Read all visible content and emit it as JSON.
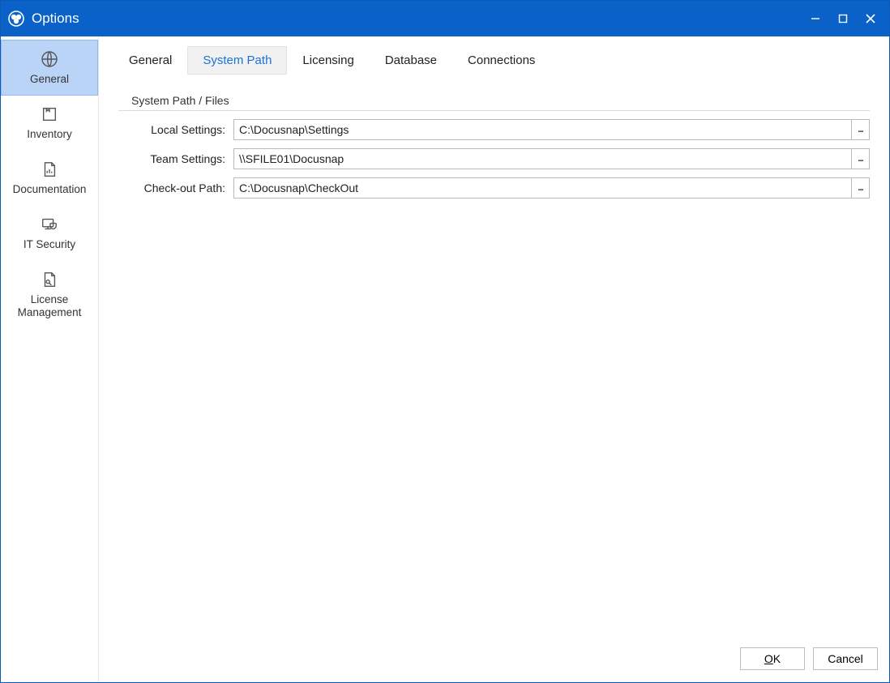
{
  "window": {
    "title": "Options"
  },
  "sidebar": {
    "items": [
      {
        "label": "General"
      },
      {
        "label": "Inventory"
      },
      {
        "label": "Documentation"
      },
      {
        "label": "IT Security"
      },
      {
        "label": "License\nManagement"
      }
    ]
  },
  "tabs": [
    {
      "label": "General"
    },
    {
      "label": "System Path"
    },
    {
      "label": "Licensing"
    },
    {
      "label": "Database"
    },
    {
      "label": "Connections"
    }
  ],
  "panel": {
    "group_title": "System Path / Files",
    "rows": [
      {
        "label": "Local Settings:",
        "value": "C:\\Docusnap\\Settings"
      },
      {
        "label": "Team Settings:",
        "value": "\\\\SFILE01\\Docusnap"
      },
      {
        "label": "Check-out Path:",
        "value": "C:\\Docusnap\\CheckOut"
      }
    ],
    "browse_label": "..."
  },
  "footer": {
    "ok_prefix": "O",
    "ok_suffix": "K",
    "cancel": "Cancel"
  }
}
